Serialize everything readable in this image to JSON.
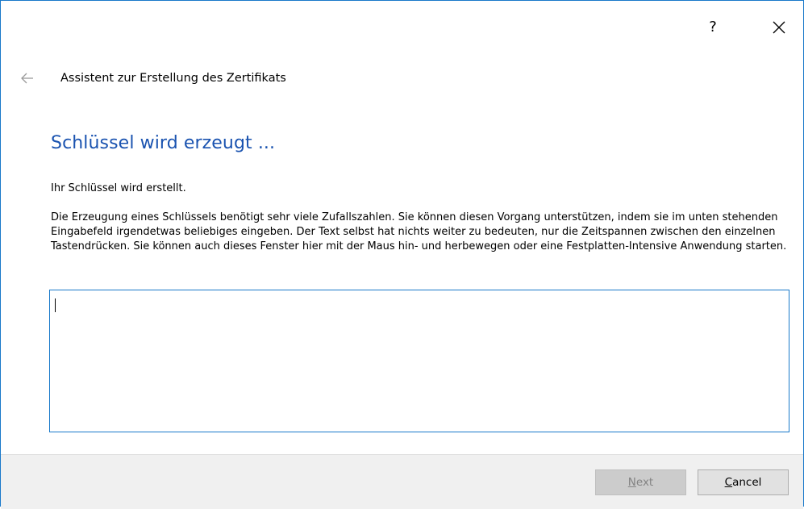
{
  "titlebar": {
    "help_label": "?",
    "close_icon": "close-icon"
  },
  "nav": {
    "back_icon": "back-arrow-icon",
    "wizard_title": "Assistent zur Erstellung des Zertifikats"
  },
  "page": {
    "heading": "Schlüssel wird erzeugt ...",
    "intro": "Ihr Schlüssel wird erstellt.",
    "description": "Die Erzeugung eines Schlüssels benötigt sehr viele Zufallszahlen. Sie können diesen Vorgang unterstützen, indem sie im unten stehenden Eingabefeld irgendetwas beliebiges eingeben. Der Text selbst hat nichts weiter zu bedeuten, nur die Zeitspannen zwischen den einzelnen Tastendrücken. Sie können auch dieses Fenster hier mit der Maus hin- und herbewegen oder eine Festplatten-Intensive Anwendung starten.",
    "entropy_input_value": ""
  },
  "footer": {
    "next_mnemonic": "N",
    "next_rest": "ext",
    "next_enabled": false,
    "cancel_mnemonic": "C",
    "cancel_rest": "ancel"
  },
  "colors": {
    "accent": "#1979ca",
    "heading": "#1a53b0",
    "footer_bg": "#f0f0f0"
  }
}
